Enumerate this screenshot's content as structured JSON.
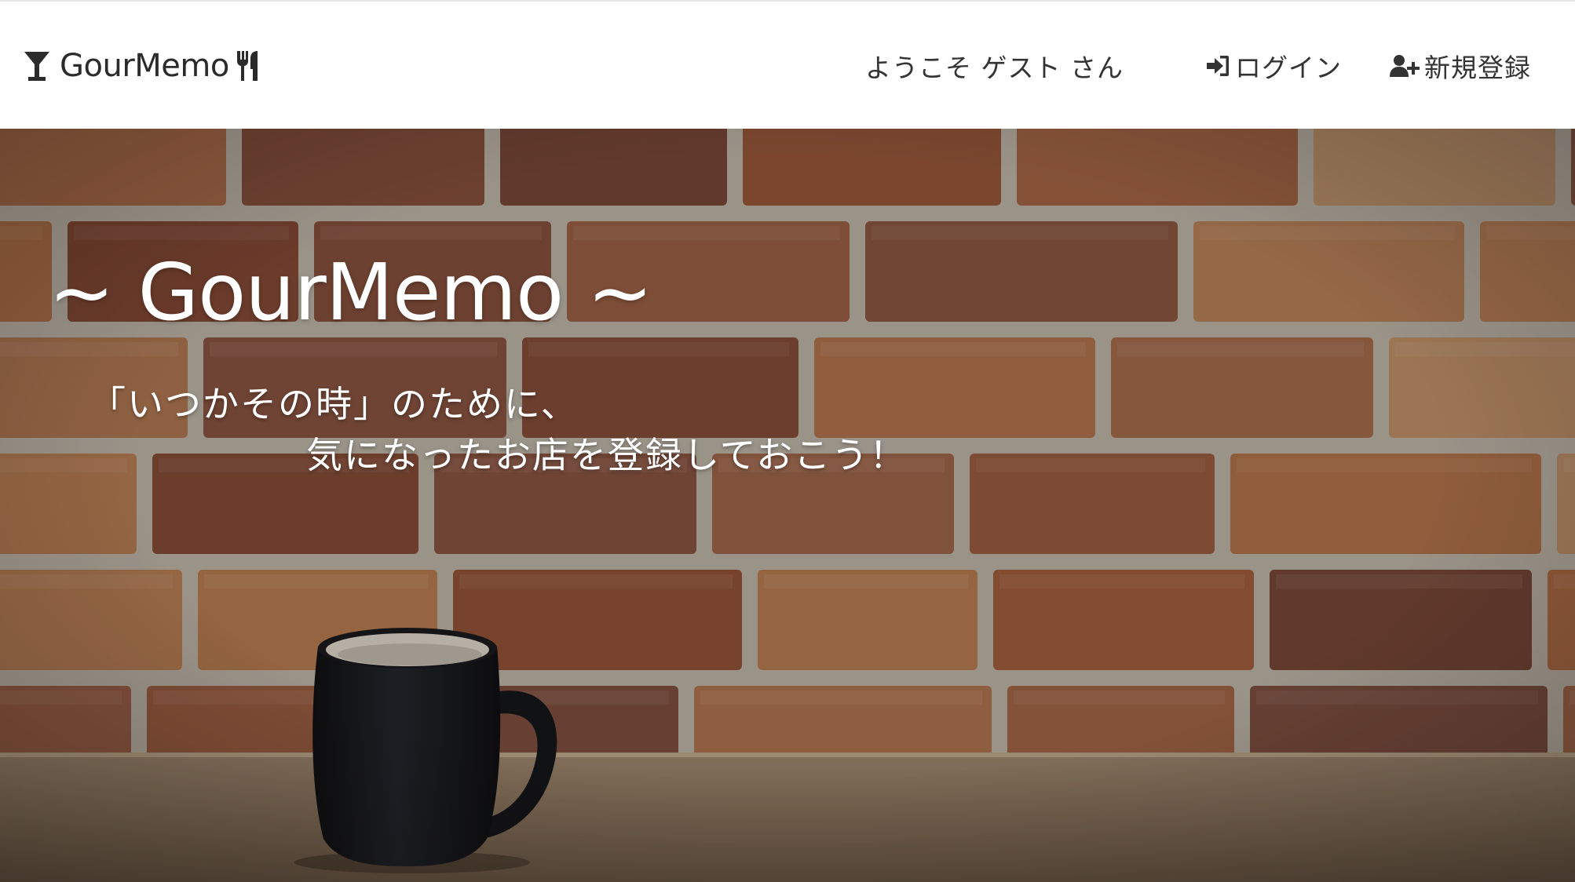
{
  "navbar": {
    "brand": {
      "label": "GourMemo",
      "icon_left": "cocktail-glass-icon",
      "icon_right": "fork-knife-icon"
    },
    "welcome_text": "ようこそ ゲスト さん",
    "login": {
      "label": "ログイン",
      "icon": "sign-in-icon"
    },
    "signup": {
      "label": "新規登録",
      "icon": "user-plus-icon"
    }
  },
  "hero": {
    "title": "~ GourMemo ~",
    "tagline_line1": "「いつかその時」のために、",
    "tagline_line2": "気になったお店を登録しておこう！",
    "background": "brick-wall-with-coffee-mug"
  },
  "colors": {
    "navbar_bg": "#ffffff",
    "nav_text": "#333333",
    "hero_text": "#ffffff",
    "brick": "#9b5a3a",
    "mortar": "#bdb6ac",
    "table": "#8a7660",
    "mug": "#15171b"
  }
}
